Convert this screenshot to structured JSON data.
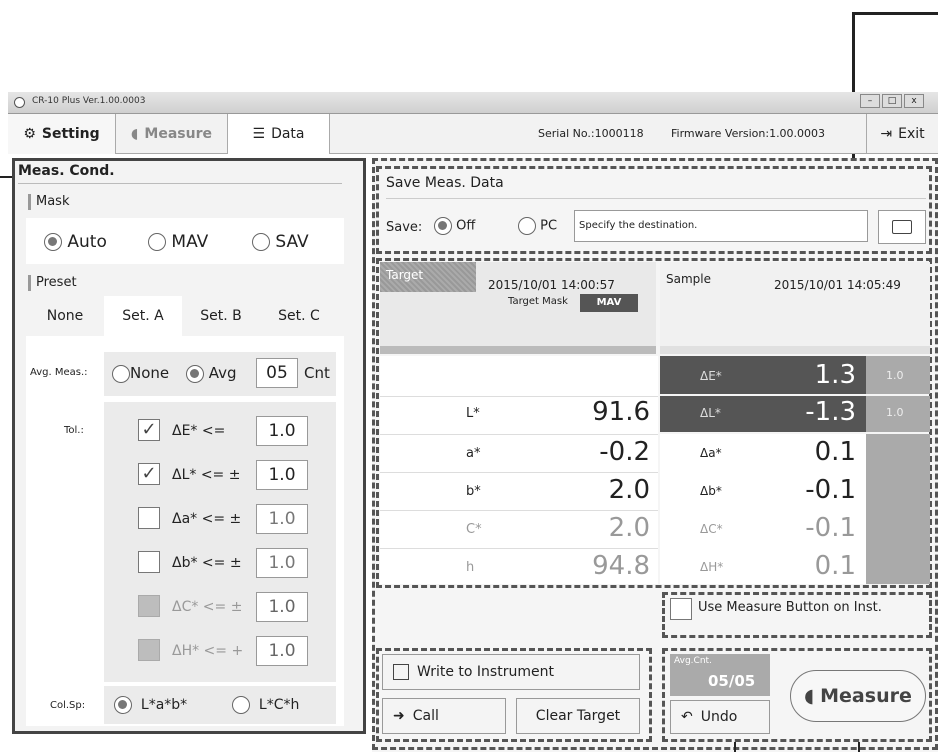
{
  "app": {
    "title": "CR-10 Plus Ver.1.00.0003"
  },
  "toolbar": {
    "setting": "Setting",
    "measure": "Measure",
    "data": "Data",
    "serial": "Serial No.:1000118",
    "firmware": "Firmware Version:1.00.0003",
    "exit": "Exit"
  },
  "meas_cond": {
    "title": "Meas. Cond.",
    "mask_label": "Mask",
    "mask_options": [
      "Auto",
      "MAV",
      "SAV"
    ],
    "mask_selected": "Auto",
    "preset_label": "Preset",
    "preset_tabs": [
      "None",
      "Set. A",
      "Set. B",
      "Set. C"
    ],
    "preset_selected": "Set. A",
    "avg_label": "Avg. Meas.:",
    "avg_none": "None",
    "avg_avg": "Avg",
    "avg_count": "05",
    "avg_unit": "Cnt",
    "tol_label": "Tol.:",
    "tolerances": [
      {
        "label": "ΔE* <=",
        "value": "1.0",
        "checked": true,
        "enabled": true
      },
      {
        "label": "ΔL* <= ±",
        "value": "1.0",
        "checked": true,
        "enabled": true
      },
      {
        "label": "Δa* <= ±",
        "value": "1.0",
        "checked": false,
        "enabled": true
      },
      {
        "label": "Δb* <= ±",
        "value": "1.0",
        "checked": false,
        "enabled": true
      },
      {
        "label": "ΔC* <= ±",
        "value": "1.0",
        "checked": false,
        "enabled": false
      },
      {
        "label": "ΔH* <= +",
        "value": "1.0",
        "checked": false,
        "enabled": false
      }
    ],
    "colsp_label": "Col.Sp:",
    "colsp_options": [
      "L*a*b*",
      "L*C*h"
    ],
    "colsp_selected": "L*a*b*"
  },
  "save": {
    "title": "Save Meas. Data",
    "save_label": "Save:",
    "off": "Off",
    "pc": "PC",
    "placeholder": "Specify the destination."
  },
  "target": {
    "label": "Target",
    "datetime": "2015/10/01 14:00:57",
    "mask_label": "Target Mask",
    "mask_value": "MAV",
    "rows": [
      {
        "label": "L*",
        "value": "91.6"
      },
      {
        "label": "a*",
        "value": "-0.2"
      },
      {
        "label": "b*",
        "value": "2.0"
      },
      {
        "label": "C*",
        "value": "2.0"
      },
      {
        "label": "h",
        "value": "94.8"
      }
    ]
  },
  "sample": {
    "label": "Sample",
    "datetime": "2015/10/01 14:05:49",
    "rows": [
      {
        "label": "ΔE*",
        "value": "1.3",
        "tol": "1.0"
      },
      {
        "label": "ΔL*",
        "value": "-1.3",
        "tol": "1.0"
      },
      {
        "label": "Δa*",
        "value": "0.1",
        "tol": ""
      },
      {
        "label": "Δb*",
        "value": "-0.1",
        "tol": ""
      },
      {
        "label": "ΔC*",
        "value": "-0.1",
        "tol": ""
      },
      {
        "label": "ΔH*",
        "value": "0.1",
        "tol": ""
      }
    ]
  },
  "use_measure_button": "Use Measure Button on Inst.",
  "buttons": {
    "write": "Write to Instrument",
    "call": "Call",
    "clear": "Clear Target",
    "avg_cnt_label": "Avg.Cnt.",
    "avg_cnt_value": "05/05",
    "undo": "Undo",
    "measure": "Measure"
  }
}
